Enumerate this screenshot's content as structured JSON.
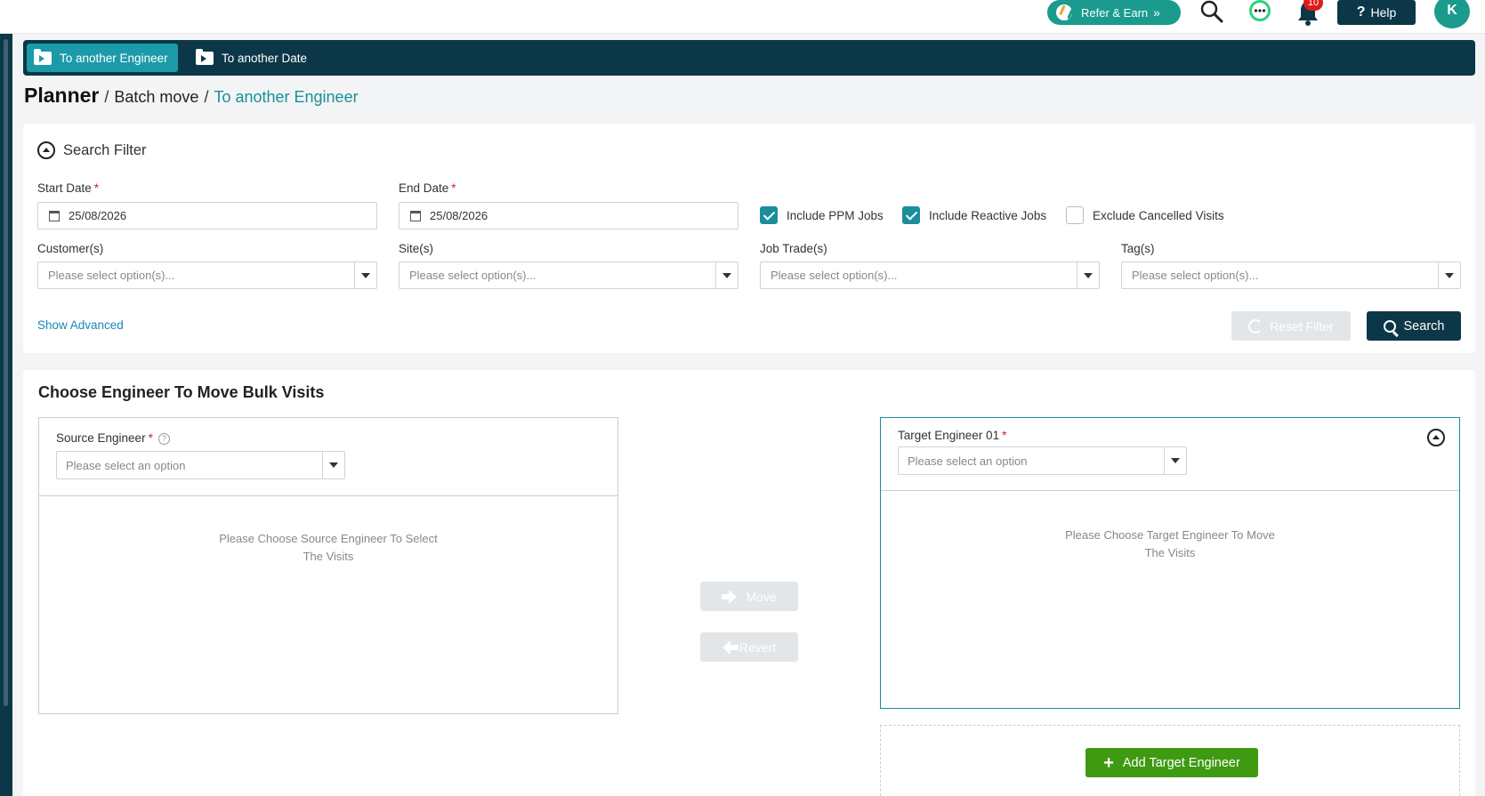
{
  "topbar": {
    "refer_label": "Refer & Earn",
    "notification_count": "10",
    "help_label": "Help",
    "avatar_initial": "K"
  },
  "tabs": [
    {
      "label": "To another Engineer",
      "active": true
    },
    {
      "label": "To another Date",
      "active": false
    }
  ],
  "breadcrumb": {
    "title": "Planner",
    "separator": "/",
    "middle": "Batch move",
    "current": "To another Engineer"
  },
  "filter": {
    "header": "Search Filter",
    "start_date_label": "Start Date",
    "start_date_value": "25/08/2026",
    "end_date_label": "End Date",
    "end_date_value": "25/08/2026",
    "required_mark": "*",
    "checkboxes": [
      {
        "label": "Include PPM Jobs",
        "checked": true
      },
      {
        "label": "Include Reactive Jobs",
        "checked": true
      },
      {
        "label": "Exclude Cancelled Visits",
        "checked": false
      }
    ],
    "customer_label": "Customer(s)",
    "site_label": "Site(s)",
    "job_trade_label": "Job Trade(s)",
    "tag_label": "Tag(s)",
    "multi_placeholder": "Please select option(s)...",
    "show_advanced": "Show Advanced",
    "reset_label": "Reset Filter",
    "search_label": "Search"
  },
  "engineer": {
    "title": "Choose Engineer To Move Bulk Visits",
    "source_label": "Source Engineer",
    "source_help": "?",
    "select_placeholder": "Please select an option",
    "source_message": "Please Choose Source Engineer To Select The Visits",
    "target_label": "Target Engineer 01",
    "target_message": "Please Choose Target Engineer To Move The Visits",
    "move_label": "Move",
    "revert_label": "Revert",
    "add_target_label": "Add Target Engineer"
  },
  "colors": {
    "navy": "#0c3748",
    "teal": "#1b8e99",
    "green": "#3f9a12",
    "required": "#d52020"
  }
}
